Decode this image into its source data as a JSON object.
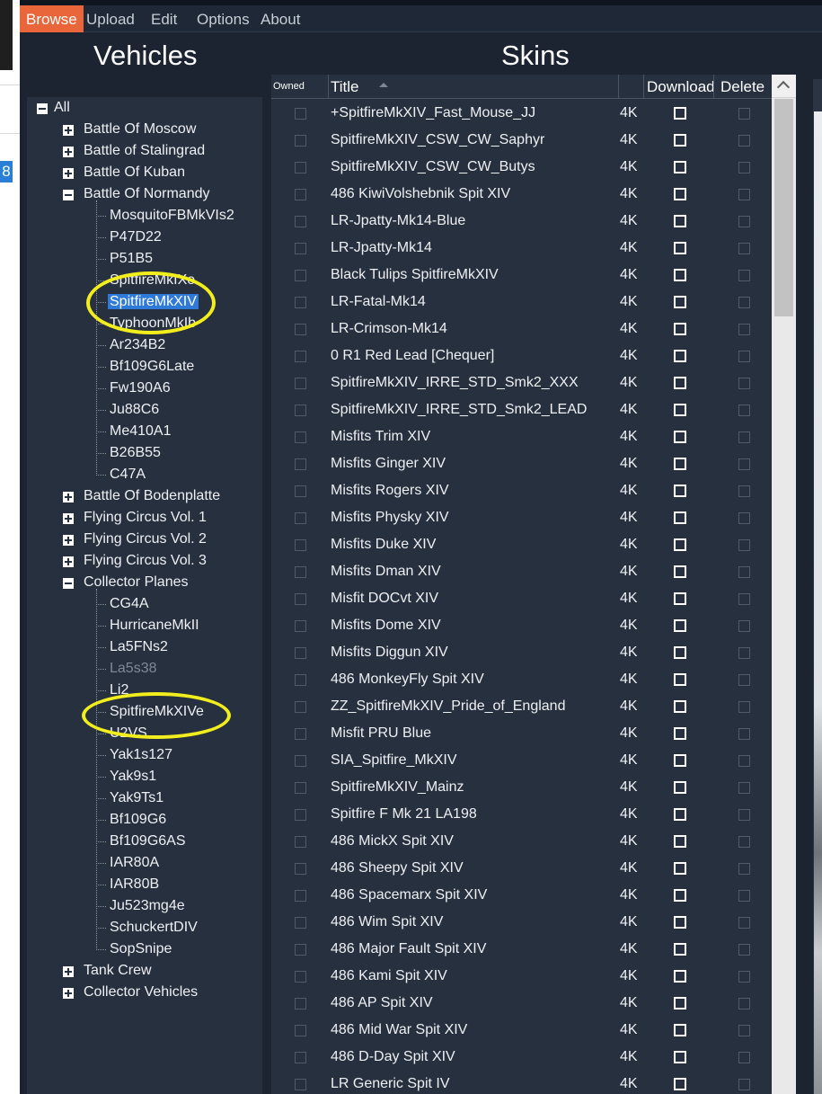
{
  "sidebar_badge": "8",
  "menu": [
    "Browse",
    "Upload",
    "Edit",
    "Options",
    "About"
  ],
  "vehicles_title": "Vehicles",
  "skins_title": "Skins",
  "tree": [
    {
      "label": "All",
      "level": 0,
      "expander": "minus"
    },
    {
      "label": "Battle Of Moscow",
      "level": 1,
      "expander": "plus"
    },
    {
      "label": "Battle of Stalingrad",
      "level": 1,
      "expander": "plus"
    },
    {
      "label": "Battle Of Kuban",
      "level": 1,
      "expander": "plus"
    },
    {
      "label": "Battle Of Normandy",
      "level": 1,
      "expander": "minus"
    },
    {
      "label": "MosquitoFBMkVIs2",
      "level": 2
    },
    {
      "label": "P47D22",
      "level": 2
    },
    {
      "label": "P51B5",
      "level": 2
    },
    {
      "label": "SpitfireMkIXe",
      "level": 2
    },
    {
      "label": "SpitfireMkXIV",
      "level": 2,
      "selected": true
    },
    {
      "label": "TyphoonMkIb",
      "level": 2
    },
    {
      "label": "Ar234B2",
      "level": 2
    },
    {
      "label": "Bf109G6Late",
      "level": 2
    },
    {
      "label": "Fw190A6",
      "level": 2
    },
    {
      "label": "Ju88C6",
      "level": 2
    },
    {
      "label": "Me410A1",
      "level": 2
    },
    {
      "label": "B26B55",
      "level": 2
    },
    {
      "label": "C47A",
      "level": 2
    },
    {
      "label": "Battle Of Bodenplatte",
      "level": 1,
      "expander": "plus"
    },
    {
      "label": "Flying Circus Vol. 1",
      "level": 1,
      "expander": "plus"
    },
    {
      "label": "Flying Circus Vol. 2",
      "level": 1,
      "expander": "plus"
    },
    {
      "label": "Flying Circus Vol. 3",
      "level": 1,
      "expander": "plus"
    },
    {
      "label": "Collector Planes",
      "level": 1,
      "expander": "minus"
    },
    {
      "label": "CG4A",
      "level": 2
    },
    {
      "label": "HurricaneMkII",
      "level": 2
    },
    {
      "label": "La5FNs2",
      "level": 2
    },
    {
      "label": "La5s38",
      "level": 2,
      "dim": true
    },
    {
      "label": "Li2",
      "level": 2
    },
    {
      "label": "SpitfireMkXIVe",
      "level": 2
    },
    {
      "label": "U2VS",
      "level": 2
    },
    {
      "label": "Yak1s127",
      "level": 2
    },
    {
      "label": "Yak9s1",
      "level": 2
    },
    {
      "label": "Yak9Ts1",
      "level": 2
    },
    {
      "label": "Bf109G6",
      "level": 2
    },
    {
      "label": "Bf109G6AS",
      "level": 2
    },
    {
      "label": "IAR80A",
      "level": 2
    },
    {
      "label": "IAR80B",
      "level": 2
    },
    {
      "label": "Ju523mg4e",
      "level": 2
    },
    {
      "label": "SchuckertDIV",
      "level": 2
    },
    {
      "label": "SopSnipe",
      "level": 2
    },
    {
      "label": "Tank Crew",
      "level": 1,
      "expander": "plus"
    },
    {
      "label": "Collector Vehicles",
      "level": 1,
      "expander": "plus"
    }
  ],
  "grid": {
    "headers": {
      "owned": "Owned",
      "title": "Title",
      "download": "Download",
      "delete": "Delete"
    },
    "rows": [
      {
        "title": "+SpitfireMkXIV_Fast_Mouse_JJ",
        "res": "4K"
      },
      {
        "title": "SpitfireMkXIV_CSW_CW_Saphyr",
        "res": "4K"
      },
      {
        "title": "SpitfireMkXIV_CSW_CW_Butys",
        "res": "4K"
      },
      {
        "title": "486 KiwiVolshebnik Spit XIV",
        "res": "4K"
      },
      {
        "title": "LR-Jpatty-Mk14-Blue",
        "res": "4K"
      },
      {
        "title": "LR-Jpatty-Mk14",
        "res": "4K"
      },
      {
        "title": "Black Tulips SpitfireMkXIV",
        "res": "4K"
      },
      {
        "title": "LR-Fatal-Mk14",
        "res": "4K"
      },
      {
        "title": "LR-Crimson-Mk14",
        "res": "4K"
      },
      {
        "title": "0 R1 Red Lead [Chequer]",
        "res": "4K"
      },
      {
        "title": "SpitfireMkXIV_IRRE_STD_Smk2_XXX",
        "res": "4K"
      },
      {
        "title": "SpitfireMkXIV_IRRE_STD_Smk2_LEAD",
        "res": "4K"
      },
      {
        "title": "Misfits Trim XIV",
        "res": "4K"
      },
      {
        "title": "Misfits Ginger XIV",
        "res": "4K"
      },
      {
        "title": "Misfits Rogers XIV",
        "res": "4K"
      },
      {
        "title": "Misfits Physky XIV",
        "res": "4K"
      },
      {
        "title": "Misfits Duke XIV",
        "res": "4K"
      },
      {
        "title": "Misfits Dman XIV",
        "res": "4K"
      },
      {
        "title": "Misfit DOCvt XIV",
        "res": "4K"
      },
      {
        "title": "Misfits Dome XIV",
        "res": "4K"
      },
      {
        "title": "Misfits Diggun XIV",
        "res": "4K"
      },
      {
        "title": "486 MonkeyFly Spit XIV",
        "res": "4K"
      },
      {
        "title": "ZZ_SpitfireMkXIV_Pride_of_England",
        "res": "4K"
      },
      {
        "title": "Misfit PRU Blue",
        "res": "4K"
      },
      {
        "title": "SIA_Spitfire_MkXIV",
        "res": "4K"
      },
      {
        "title": "SpitfireMkXIV_Mainz",
        "res": "4K"
      },
      {
        "title": "Spitfire F Mk 21 LA198",
        "res": "4K"
      },
      {
        "title": "486 MickX Spit XIV",
        "res": "4K"
      },
      {
        "title": "486 Sheepy Spit XIV",
        "res": "4K"
      },
      {
        "title": "486 Spacemarx Spit XIV",
        "res": "4K"
      },
      {
        "title": "486 Wim Spit XIV",
        "res": "4K"
      },
      {
        "title": "486 Major Fault Spit XIV",
        "res": "4K"
      },
      {
        "title": "486 Kami Spit XIV",
        "res": "4K"
      },
      {
        "title": "486 AP Spit XIV",
        "res": "4K"
      },
      {
        "title": "486 Mid War Spit XIV",
        "res": "4K"
      },
      {
        "title": "486 D-Day Spit XIV",
        "res": "4K"
      },
      {
        "title": "LR Generic Spit IV",
        "res": "4K"
      }
    ]
  },
  "colors": {
    "accent": "#e8663a",
    "selected": "#2f7ad8",
    "highlight_circle": "#f2ee1e"
  }
}
